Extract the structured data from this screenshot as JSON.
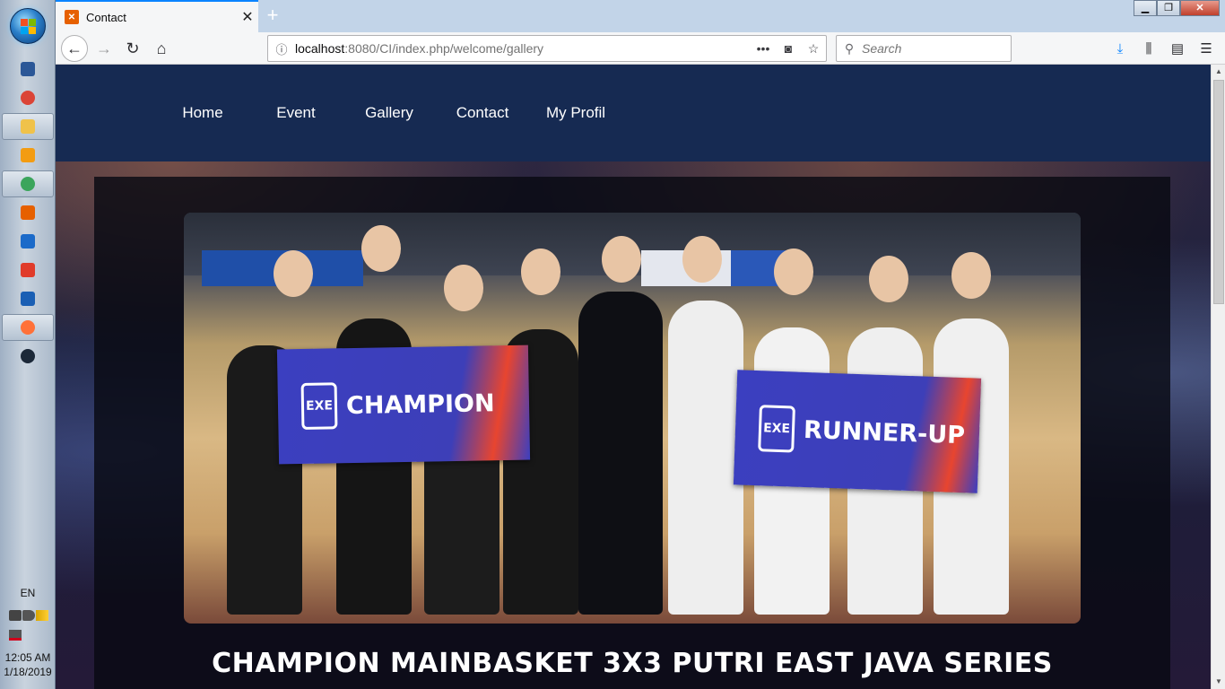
{
  "taskbar": {
    "language": "EN",
    "time": "12:05 AM",
    "date": "1/18/2019",
    "pinned": [
      {
        "icon": "word-icon",
        "color": "#2b5797"
      },
      {
        "icon": "chrome-icon",
        "color": "#db4437"
      },
      {
        "icon": "file-explorer-icon",
        "color": "#f0c24a"
      },
      {
        "icon": "media-player-icon",
        "color": "#f39c12"
      },
      {
        "icon": "atom-icon",
        "color": "#3ba55c"
      },
      {
        "icon": "xampp-icon",
        "color": "#e66000"
      },
      {
        "icon": "virtualbox-icon",
        "color": "#1b6ac9"
      },
      {
        "icon": "git-icon",
        "color": "#e03b2a"
      },
      {
        "icon": "filezilla-icon",
        "color": "#1a5fb4"
      },
      {
        "icon": "firefox-icon",
        "color": "#ff7139"
      },
      {
        "icon": "steam-icon",
        "color": "#1b2838"
      }
    ]
  },
  "browser": {
    "tab_title": "Contact",
    "url_host": "localhost",
    "url_rest": ":8080/CI/index.php/welcome/gallery",
    "search_placeholder": "Search"
  },
  "site": {
    "nav": [
      "Home",
      "Event",
      "Gallery",
      "Contact",
      "My Profil"
    ],
    "banner_left": "CHAMPION",
    "banner_right": "RUNNER-UP",
    "banner_logo": "EXE",
    "caption": "CHAMPION MAINBASKET 3X3 PUTRI EAST JAVA SERIES"
  },
  "colors": {
    "header_bg": "#162a52",
    "accent": "#0a84ff"
  }
}
